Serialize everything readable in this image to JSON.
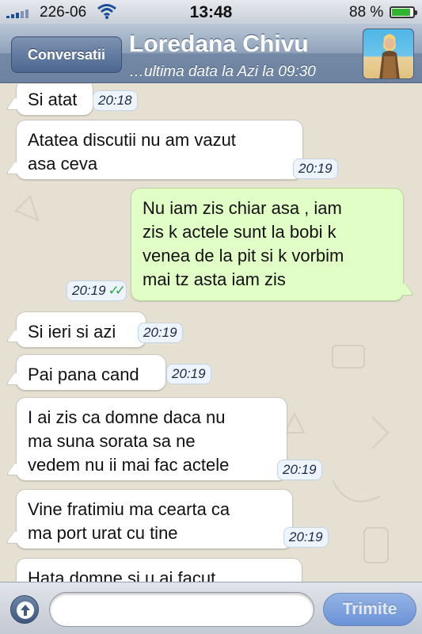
{
  "status_bar": {
    "carrier": "226-06",
    "time": "13:48",
    "battery_percent": "88 %",
    "battery_level": 0.88,
    "icons": {
      "signal": "signal-bars-icon",
      "wifi": "wifi-icon",
      "battery": "battery-icon"
    }
  },
  "nav": {
    "back_label": "Conversatii",
    "contact_name": "Loredana Chivu",
    "last_seen": "…ultima data la Azi la 09:30"
  },
  "messages": [
    {
      "direction": "in",
      "text": "Si atat",
      "time": "20:18"
    },
    {
      "direction": "in",
      "text": "Atatea discutii nu am vazut\nasa ceva",
      "time": "20:19"
    },
    {
      "direction": "out",
      "text": "Nu iam zis chiar asa , iam\nzis k actele sunt la bobi k\nvenea de la pit si k vorbim\nmai tz asta iam zis",
      "time": "20:19",
      "ticks": "✓✓"
    },
    {
      "direction": "in",
      "text": "Si ieri si azi",
      "time": "20:19"
    },
    {
      "direction": "in",
      "text": "Pai pana cand",
      "time": "20:19"
    },
    {
      "direction": "in",
      "text": "I ai zis ca domne daca nu\nma suna sorata sa ne\nvedem nu ii mai fac actele",
      "time": "20:19"
    },
    {
      "direction": "in",
      "text": "Vine fratimiu ma cearta ca\nma port urat cu tine",
      "time": "20:19"
    },
    {
      "direction": "in",
      "text": "Hata domne si u ai facut",
      "time": ""
    }
  ],
  "input_bar": {
    "placeholder": "",
    "send_label": "Trimite",
    "attach_icon": "arrow-up-icon"
  },
  "colors": {
    "incoming_bubble": "#ffffff",
    "outgoing_bubble": "#e1fec6",
    "nav_bar": "#7489a5",
    "read_ticks": "#2fa84f",
    "battery_fill": "#2fb52f"
  }
}
